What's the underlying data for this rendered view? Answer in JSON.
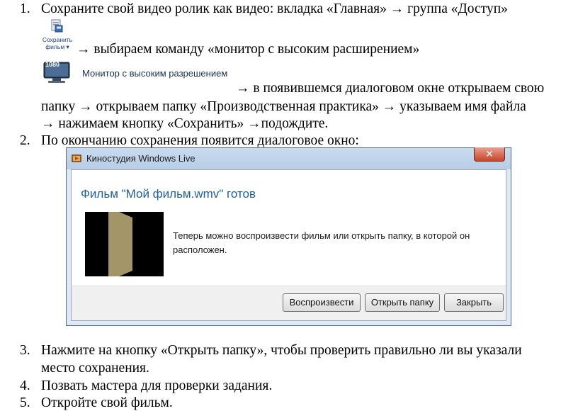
{
  "items": [
    {
      "number": "1.",
      "lines": [
        "Сохраните свой видео ролик как видео: вкладка «Главная» → группа «Доступ»",
        "→   выбираем   команду   «монитор   с   высоким   расширением»",
        "→ в появившемся диалоговом окне открываем свою",
        "папку → открываем папку «Производственная практика» → указываем имя файла",
        "→ нажимаем кнопку «Сохранить» →подождите."
      ]
    },
    {
      "number": "2.",
      "lines": [
        "По окончанию сохранения появится диалоговое окно:"
      ]
    },
    {
      "number": "3.",
      "lines": [
        "Нажмите на кнопку «Открыть папку», чтобы проверить правильно ли вы указали",
        "место сохранения."
      ]
    },
    {
      "number": "4.",
      "lines": [
        "Позвать мастера для проверки задания."
      ]
    },
    {
      "number": "5.",
      "lines": [
        "Откройте свой фильм."
      ]
    }
  ],
  "ribbon_button": {
    "label_line1": "Сохранить",
    "label_line2": "фильм ▾",
    "icon": "save-movie-icon"
  },
  "monitor_option": {
    "badge": "1080",
    "label": "Монитор с высоким разрешением",
    "icon": "monitor-icon"
  },
  "dialog": {
    "title": "Киностудия Windows Live",
    "close_label": "✕",
    "heading": "Фильм \"Мой фильм.wmv\" готов",
    "message": "Теперь можно воспроизвести фильм или открыть папку, в которой он расположен.",
    "buttons": {
      "play": "Воспроизвести",
      "open_folder": "Открыть папку",
      "close": "Закрыть"
    }
  },
  "colors": {
    "dialog_heading": "#1f5fa0",
    "thumbnail_gold": "#a29567",
    "close_button": "#c8452a"
  }
}
